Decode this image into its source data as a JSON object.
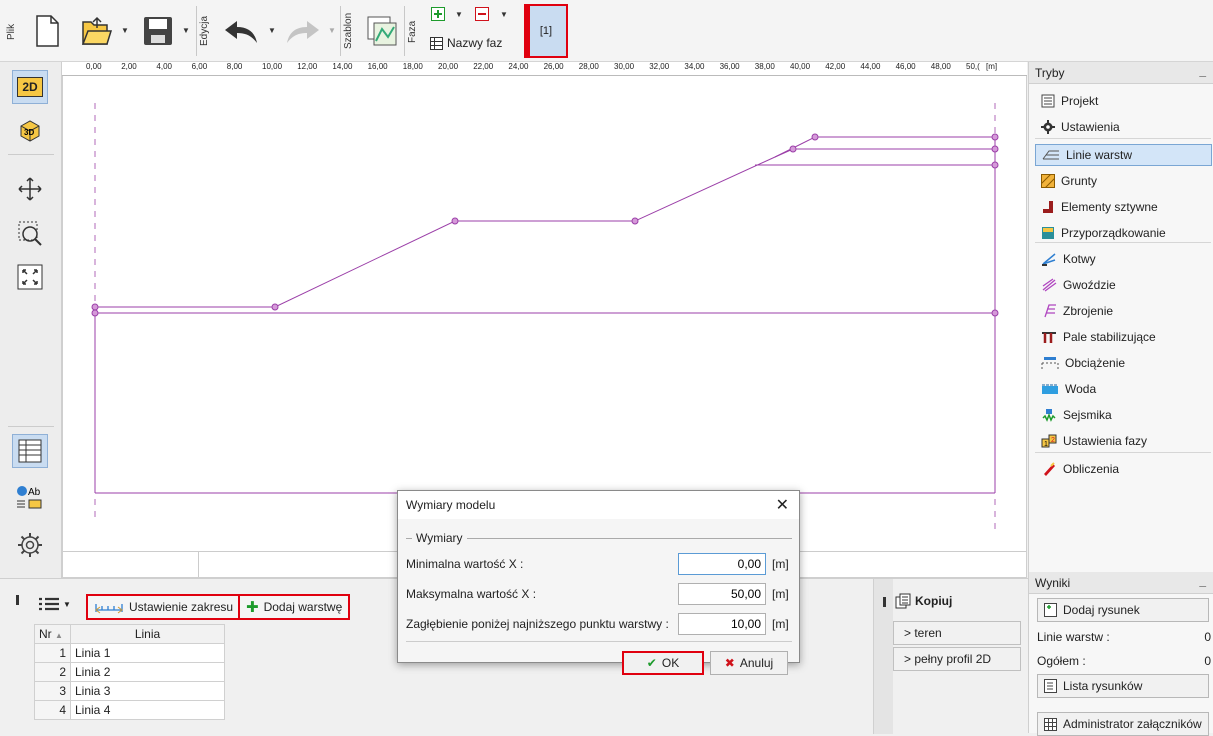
{
  "toolbar": {
    "file_label": "Plik",
    "edit_label": "Edycja",
    "template_label": "Szablon",
    "phase_label": "Faza",
    "phase_names_label": "Nazwy faz",
    "phase_tab": "[1]"
  },
  "ruler": {
    "ticks": [
      "0,00",
      "2,00",
      "4,00",
      "6,00",
      "8,00",
      "10,00",
      "12,00",
      "14,00",
      "16,00",
      "18,00",
      "20,00",
      "22,00",
      "24,00",
      "26,00",
      "28,00",
      "30,00",
      "32,00",
      "34,00",
      "36,00",
      "38,00",
      "40,00",
      "42,00",
      "44,00",
      "46,00",
      "48,00",
      "50,("
    ],
    "unit": "[m]"
  },
  "left_tools": {
    "view_2d": "2D"
  },
  "modes_panel": {
    "title": "Tryby",
    "items": [
      {
        "label": "Projekt",
        "icon": "document-icon"
      },
      {
        "label": "Ustawienia",
        "icon": "gear-icon"
      },
      {
        "label": "Linie warstw",
        "icon": "layer-lines-icon",
        "active": true
      },
      {
        "label": "Grunty",
        "icon": "soil-icon"
      },
      {
        "label": "Elementy sztywne",
        "icon": "rigid-body-icon"
      },
      {
        "label": "Przyporządkowanie",
        "icon": "assign-icon"
      },
      {
        "label": "Kotwy",
        "icon": "anchor-icon"
      },
      {
        "label": "Gwoździe",
        "icon": "nails-icon"
      },
      {
        "label": "Zbrojenie",
        "icon": "reinforcement-icon"
      },
      {
        "label": "Pale stabilizujące",
        "icon": "piles-icon"
      },
      {
        "label": "Obciążenie",
        "icon": "load-icon"
      },
      {
        "label": "Woda",
        "icon": "water-icon"
      },
      {
        "label": "Sejsmika",
        "icon": "seismic-icon"
      },
      {
        "label": "Ustawienia fazy",
        "icon": "phase-settings-icon"
      },
      {
        "label": "Obliczenia",
        "icon": "calculation-icon"
      }
    ]
  },
  "results_panel": {
    "title": "Wyniki",
    "add_drawing": "Dodaj rysunek",
    "layer_lines_label": "Linie warstw :",
    "layer_lines_count": "0",
    "total_label": "Ogółem :",
    "total_count": "0",
    "drawings_list": "Lista rysunków",
    "attachments_admin": "Administrator załączników"
  },
  "bottom": {
    "range_setting": "Ustawienie zakresu",
    "add_layer": "Dodaj warstwę",
    "table_headers": {
      "nr": "Nr",
      "line": "Linia"
    },
    "rows": [
      {
        "nr": "1",
        "name": "Linia 1"
      },
      {
        "nr": "2",
        "name": "Linia 2"
      },
      {
        "nr": "3",
        "name": "Linia 3"
      },
      {
        "nr": "4",
        "name": "Linia 4"
      }
    ],
    "copy_title": "Kopiuj",
    "copy_terrain": "> teren",
    "copy_full_profile": "> pełny profil 2D"
  },
  "dialog": {
    "title": "Wymiary modelu",
    "group_label": "Wymiary",
    "min_x_label": "Minimalna wartość X :",
    "min_x_value": "0,00",
    "max_x_label": "Maksymalna wartość X :",
    "max_x_value": "50,00",
    "depth_label": "Zagłębienie poniżej najniższego punktu warstwy :",
    "depth_value": "10,00",
    "unit": "[m]",
    "ok": "OK",
    "cancel": "Anuluj"
  },
  "colors": {
    "layer_line": "#9b3fa8",
    "highlight": "#e0000f",
    "active_bg": "#c9dcf1"
  }
}
